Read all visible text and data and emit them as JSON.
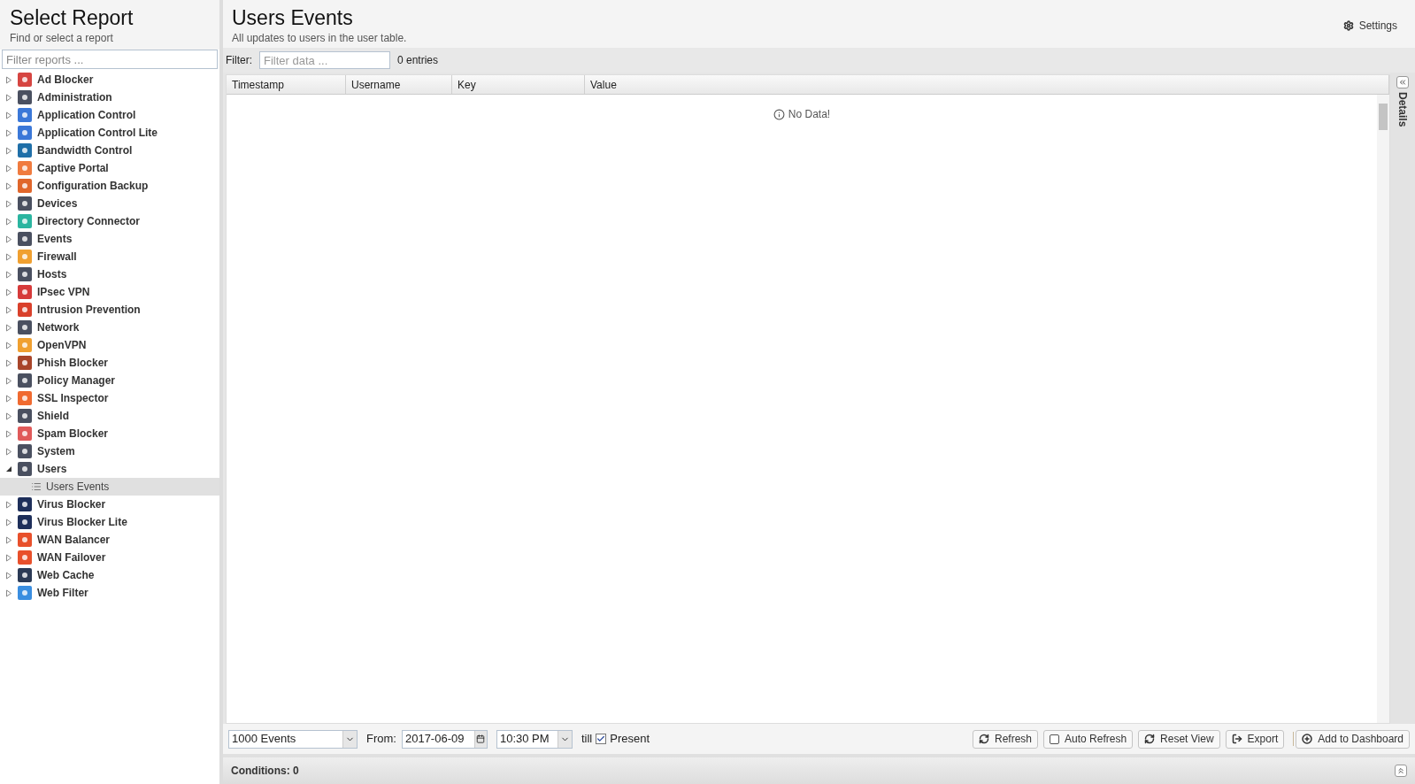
{
  "sidebar": {
    "title": "Select Report",
    "subtitle": "Find or select a report",
    "search": {
      "placeholder": "Filter reports ..."
    },
    "items": [
      {
        "label": "Ad Blocker",
        "color": "#d64541",
        "expanded": false
      },
      {
        "label": "Administration",
        "color": "#4a5060",
        "expanded": false
      },
      {
        "label": "Application Control",
        "color": "#3b78d8",
        "expanded": false
      },
      {
        "label": "Application Control Lite",
        "color": "#3b78d8",
        "expanded": false
      },
      {
        "label": "Bandwidth Control",
        "color": "#1f6fa8",
        "expanded": false
      },
      {
        "label": "Captive Portal",
        "color": "#f07b3f",
        "expanded": false
      },
      {
        "label": "Configuration Backup",
        "color": "#e0662b",
        "expanded": false
      },
      {
        "label": "Devices",
        "color": "#4a5060",
        "expanded": false
      },
      {
        "label": "Directory Connector",
        "color": "#2bb5a0",
        "expanded": false
      },
      {
        "label": "Events",
        "color": "#4a5060",
        "expanded": false
      },
      {
        "label": "Firewall",
        "color": "#f0a030",
        "expanded": false
      },
      {
        "label": "Hosts",
        "color": "#4a5060",
        "expanded": false
      },
      {
        "label": "IPsec VPN",
        "color": "#d63a3a",
        "expanded": false
      },
      {
        "label": "Intrusion Prevention",
        "color": "#d9402b",
        "expanded": false
      },
      {
        "label": "Network",
        "color": "#4a5060",
        "expanded": false
      },
      {
        "label": "OpenVPN",
        "color": "#f0a030",
        "expanded": false
      },
      {
        "label": "Phish Blocker",
        "color": "#a8452a",
        "expanded": false
      },
      {
        "label": "Policy Manager",
        "color": "#4a5060",
        "expanded": false
      },
      {
        "label": "SSL Inspector",
        "color": "#f06a30",
        "expanded": false
      },
      {
        "label": "Shield",
        "color": "#4a5060",
        "expanded": false
      },
      {
        "label": "Spam Blocker",
        "color": "#e05a5a",
        "expanded": false
      },
      {
        "label": "System",
        "color": "#4a5060",
        "expanded": false
      },
      {
        "label": "Users",
        "color": "#4a5060",
        "expanded": true,
        "children": [
          {
            "label": "Users Events",
            "selected": true
          }
        ]
      },
      {
        "label": "Virus Blocker",
        "color": "#1e2f5a",
        "expanded": false
      },
      {
        "label": "Virus Blocker Lite",
        "color": "#1e2f5a",
        "expanded": false
      },
      {
        "label": "WAN Balancer",
        "color": "#e8502b",
        "expanded": false
      },
      {
        "label": "WAN Failover",
        "color": "#e8502b",
        "expanded": false
      },
      {
        "label": "Web Cache",
        "color": "#2b3a55",
        "expanded": false
      },
      {
        "label": "Web Filter",
        "color": "#3a8ee0",
        "expanded": false
      }
    ]
  },
  "report": {
    "title": "Users Events",
    "subtitle": "All updates to users in the user table.",
    "settings": "Settings"
  },
  "filter": {
    "label": "Filter:",
    "placeholder": "Filter data ...",
    "count": "0 entries"
  },
  "table": {
    "columns": [
      "Timestamp",
      "Username",
      "Key",
      "Value"
    ],
    "empty": "No Data!"
  },
  "details": {
    "label": "Details"
  },
  "toolbar": {
    "limit": "1000 Events",
    "from_label": "From:",
    "date": "2017-06-09",
    "time": "10:30 PM",
    "till": "till",
    "present": {
      "label": "Present",
      "checked": true
    },
    "buttons": [
      {
        "kind": "refresh",
        "label": "Refresh"
      },
      {
        "kind": "checkbox",
        "label": "Auto Refresh",
        "checked": false
      },
      {
        "kind": "refresh",
        "label": "Reset View"
      },
      {
        "kind": "export",
        "label": "Export"
      },
      {
        "kind": "add",
        "label": "Add to Dashboard"
      }
    ]
  },
  "conditions": "Conditions: 0"
}
